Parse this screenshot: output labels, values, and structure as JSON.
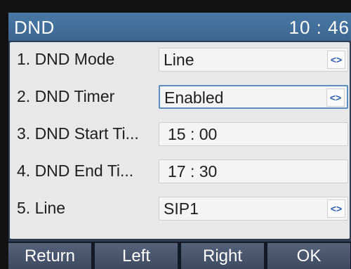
{
  "header": {
    "title": "DND",
    "time": "10 : 46"
  },
  "rows": [
    {
      "label": "1. DND Mode",
      "value": "Line",
      "arrow": "<>"
    },
    {
      "label": "2. DND Timer",
      "value": "Enabled",
      "arrow": "<>"
    },
    {
      "label": "3. DND Start Ti...",
      "value": "15 : 00"
    },
    {
      "label": "4. DND End Ti...",
      "value": "17 : 30"
    },
    {
      "label": "5. Line",
      "value": "SIP1",
      "arrow": "<>"
    }
  ],
  "softkeys": [
    "Return",
    "Left",
    "Right",
    "OK"
  ],
  "colors": {
    "header": "#3c6690",
    "panel": "#e8e8e8",
    "focus_border": "#5a8ec0",
    "softkey": "#4a566d"
  }
}
